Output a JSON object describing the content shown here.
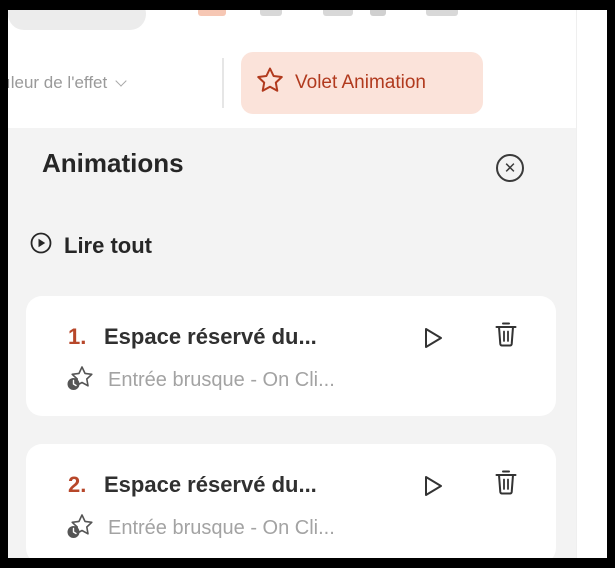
{
  "toolbar": {
    "effect_label": "ıleur de l'effet",
    "animation_pane_label": "Volet Animation",
    "colors": {
      "accent_bg": "#fbe3da",
      "accent_text": "#b13a1e"
    }
  },
  "panel": {
    "title": "Animations",
    "play_all_label": "Lire tout",
    "items": [
      {
        "number": "1.",
        "title": "Espace réservé du...",
        "subtitle": "Entrée brusque - On Cli...",
        "icon": "effect-star-icon"
      },
      {
        "number": "2.",
        "title": "Espace réservé du...",
        "subtitle": "Entrée brusque - On Cli...",
        "icon": "effect-star-icon"
      }
    ],
    "colors": {
      "number": "#b7472a",
      "background": "#f3f3f3",
      "card": "#ffffff"
    }
  }
}
